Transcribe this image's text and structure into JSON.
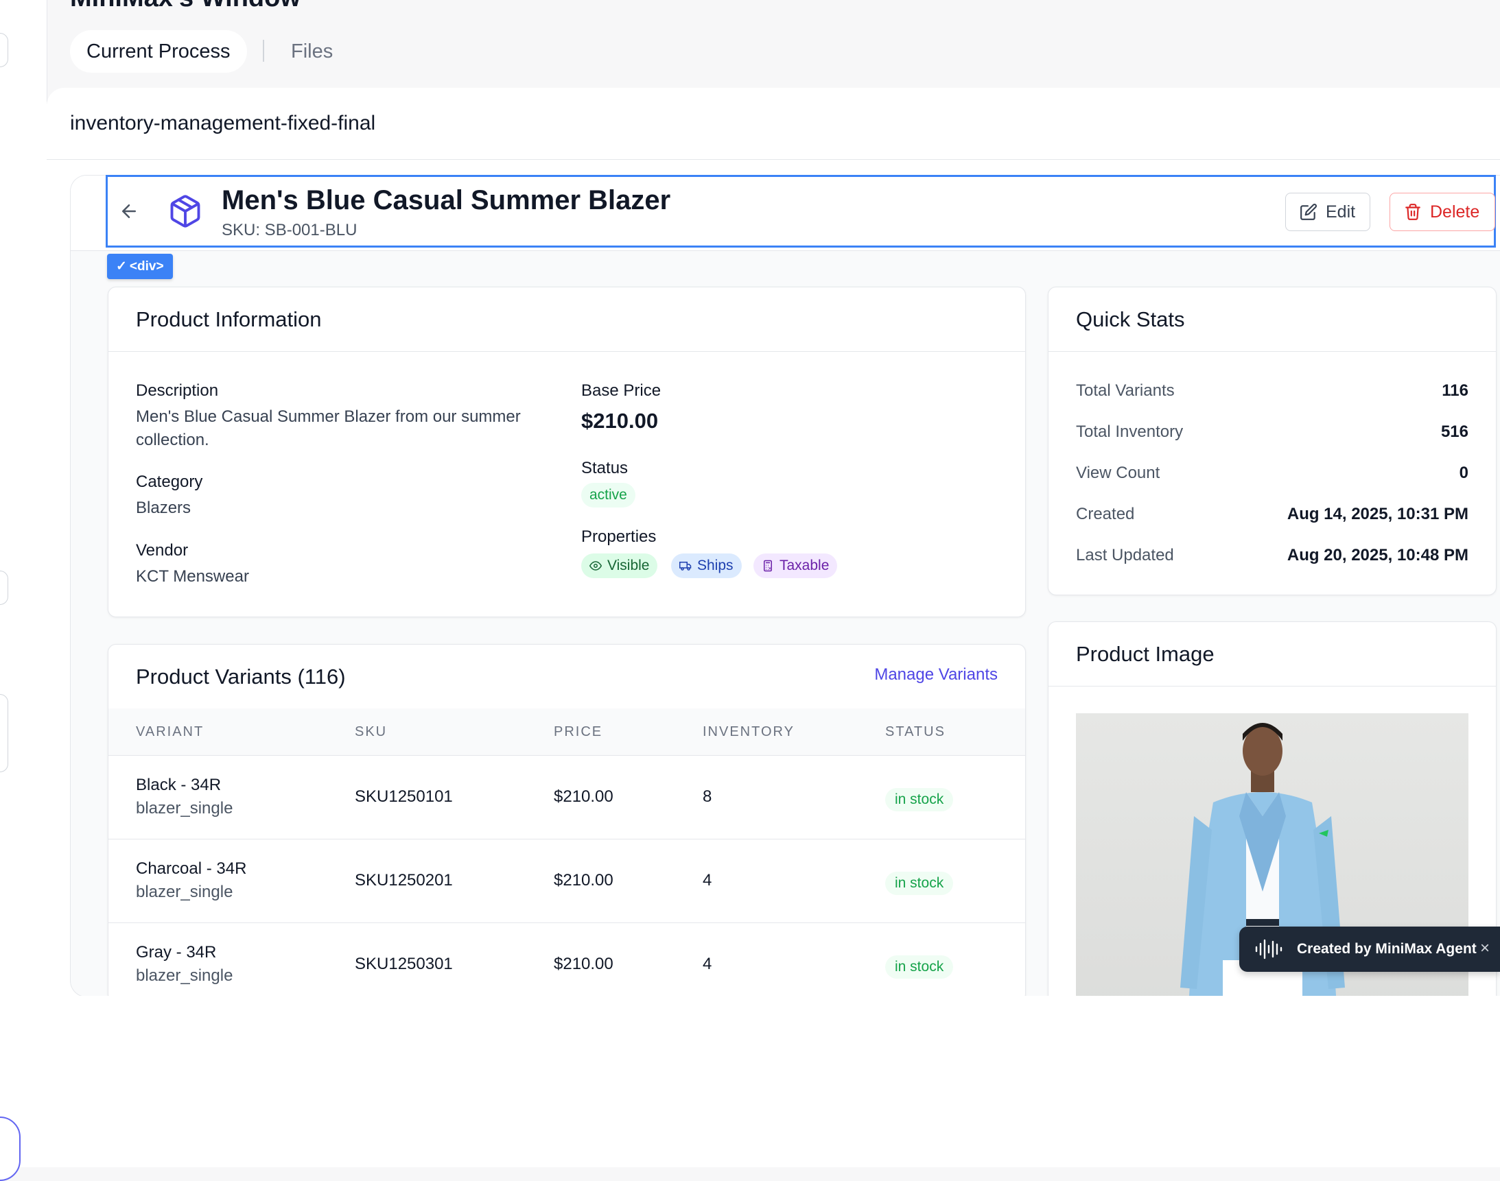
{
  "window": {
    "title": "MiniMax's Window"
  },
  "tabs": {
    "current": "Current Process",
    "files": "Files"
  },
  "file": {
    "name": "inventory-management-fixed-final"
  },
  "inspector": {
    "badge_check": "✓",
    "badge_tag": "<div>"
  },
  "product": {
    "title": "Men's Blue Casual Summer Blazer",
    "sku": "SKU: SB-001-BLU",
    "edit_label": "Edit",
    "delete_label": "Delete"
  },
  "info": {
    "heading": "Product Information",
    "description_label": "Description",
    "description": "Men's Blue Casual Summer Blazer from our summer collection.",
    "category_label": "Category",
    "category": "Blazers",
    "vendor_label": "Vendor",
    "vendor": "KCT Menswear",
    "base_price_label": "Base Price",
    "base_price": "$210.00",
    "status_label": "Status",
    "status": "active",
    "properties_label": "Properties",
    "properties": [
      "Visible",
      "Ships",
      "Taxable"
    ]
  },
  "stats": {
    "heading": "Quick Stats",
    "rows": [
      {
        "label": "Total Variants",
        "value": "116"
      },
      {
        "label": "Total Inventory",
        "value": "516"
      },
      {
        "label": "View Count",
        "value": "0"
      },
      {
        "label": "Created",
        "value": "Aug 14, 2025, 10:31 PM"
      },
      {
        "label": "Last Updated",
        "value": "Aug 20, 2025, 10:48 PM"
      }
    ]
  },
  "image_card": {
    "heading": "Product Image"
  },
  "variants": {
    "heading": "Product Variants (116)",
    "manage_label": "Manage Variants",
    "columns": [
      "VARIANT",
      "SKU",
      "PRICE",
      "INVENTORY",
      "STATUS"
    ],
    "rows": [
      {
        "name": "Black - 34R",
        "type": "blazer_single",
        "sku": "SKU1250101",
        "price": "$210.00",
        "inventory": "8",
        "status": "in stock"
      },
      {
        "name": "Charcoal - 34R",
        "type": "blazer_single",
        "sku": "SKU1250201",
        "price": "$210.00",
        "inventory": "4",
        "status": "in stock"
      },
      {
        "name": "Gray - 34R",
        "type": "blazer_single",
        "sku": "SKU1250301",
        "price": "$210.00",
        "inventory": "4",
        "status": "in stock"
      }
    ]
  },
  "toast": {
    "text": "Created by MiniMax Agent",
    "close": "×"
  },
  "colors": {
    "accent": "#4f46e5",
    "highlight": "#3b82f6",
    "success": "#16a34a",
    "danger": "#dc2626"
  }
}
